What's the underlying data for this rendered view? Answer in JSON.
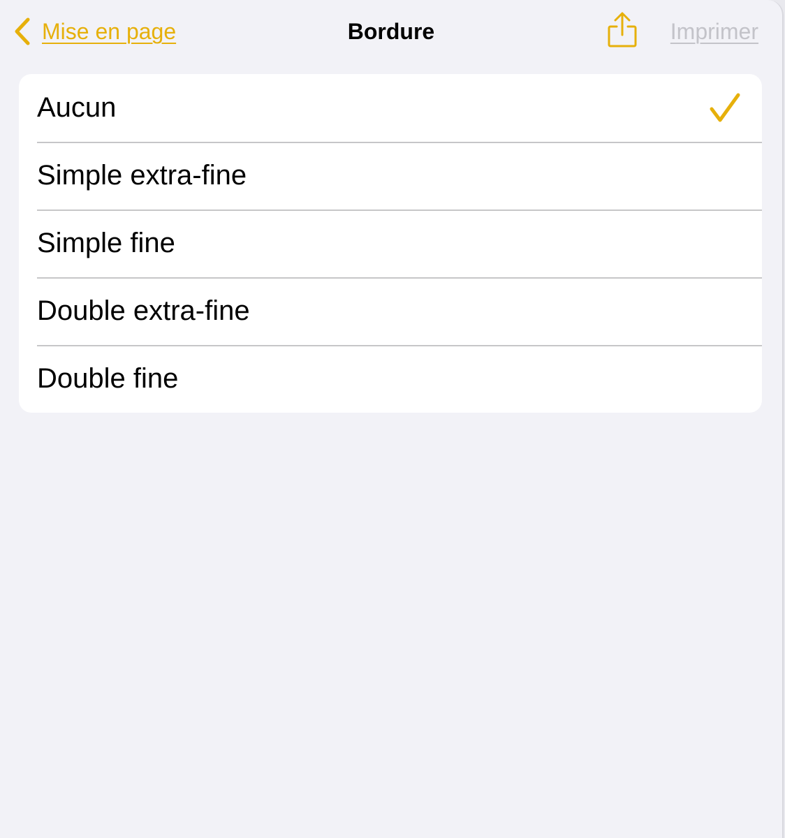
{
  "colors": {
    "accent": "#e6b00b",
    "background": "#f2f2f7",
    "card": "#ffffff",
    "separator": "#c6c6c8",
    "disabled": "#c3c3c9",
    "text": "#000000"
  },
  "navbar": {
    "back_label": "Mise en page",
    "back_icon": "chevron-left-icon",
    "title": "Bordure",
    "share_icon": "share-icon",
    "print_label": "Imprimer"
  },
  "options": [
    {
      "label": "Aucun",
      "selected": true
    },
    {
      "label": "Simple extra-fine",
      "selected": false
    },
    {
      "label": "Simple fine",
      "selected": false
    },
    {
      "label": "Double extra-fine",
      "selected": false
    },
    {
      "label": "Double fine",
      "selected": false
    }
  ]
}
